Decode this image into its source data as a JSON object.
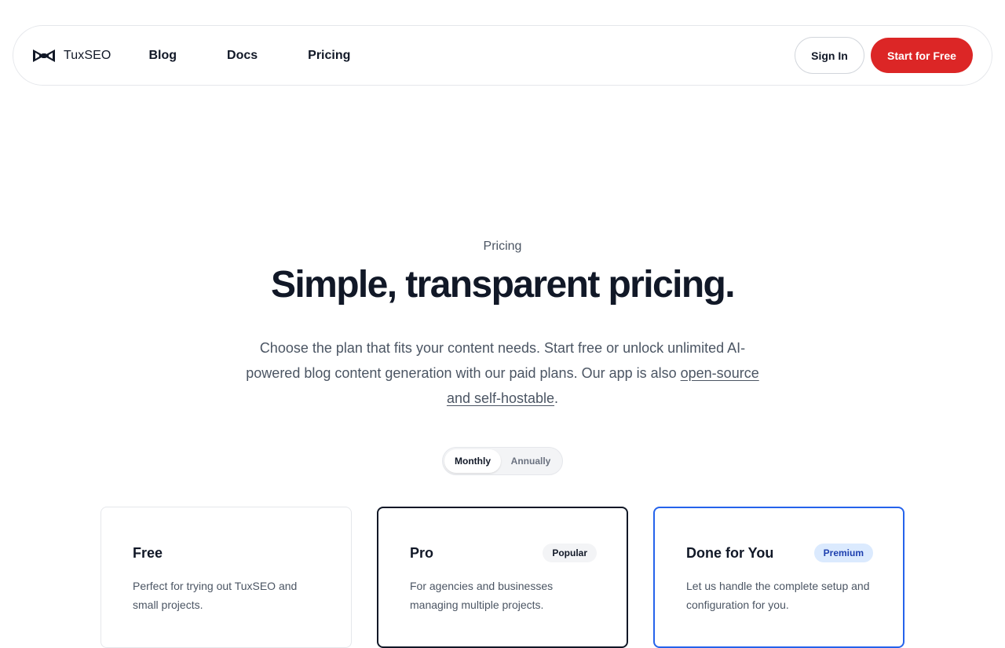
{
  "nav": {
    "brand": "TuxSEO",
    "logo_icon": "bow-tie-icon",
    "links": [
      "Blog",
      "Docs",
      "Pricing"
    ],
    "sign_in": "Sign In",
    "start_free": "Start for Free"
  },
  "colors": {
    "accent": "#dc2626",
    "premium_border": "#2563eb",
    "pro_border": "#111827"
  },
  "hero": {
    "eyebrow": "Pricing",
    "title": "Simple, transparent pricing.",
    "subtitle_part1": "Choose the plan that fits your content needs. Start free or unlock unlimited AI-powered blog content generation with our paid plans. Our app is also ",
    "subtitle_link": "open-source and self-hostable",
    "subtitle_end": "."
  },
  "billing_toggle": {
    "options": [
      "Monthly",
      "Annually"
    ],
    "selected": "Monthly"
  },
  "plans": [
    {
      "name": "Free",
      "badge": "",
      "description": "Perfect for trying out TuxSEO and small projects."
    },
    {
      "name": "Pro",
      "badge": "Popular",
      "description": "For agencies and businesses managing multiple projects."
    },
    {
      "name": "Done for You",
      "badge": "Premium",
      "description": "Let us handle the complete setup and configuration for you."
    }
  ]
}
